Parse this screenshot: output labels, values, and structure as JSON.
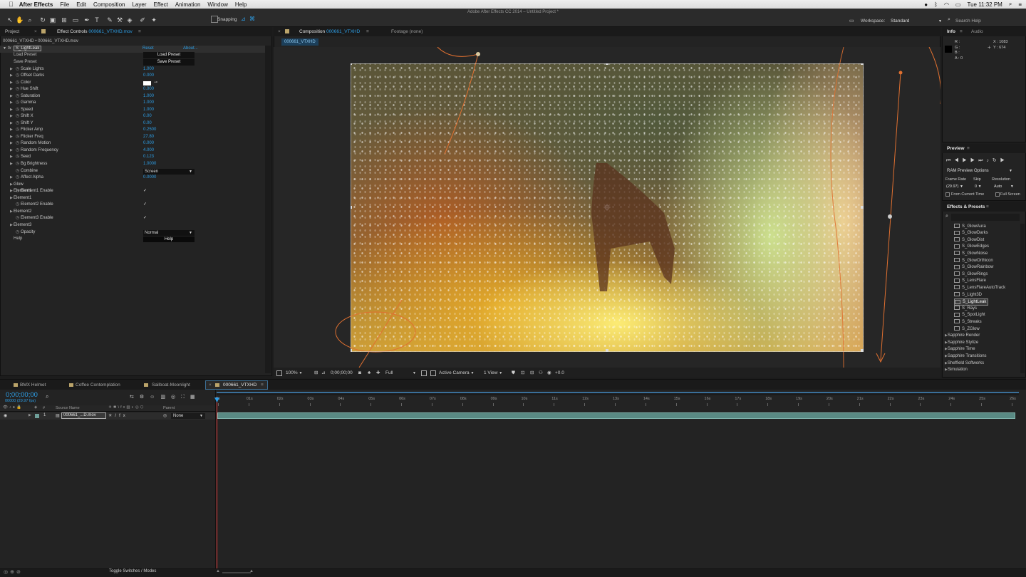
{
  "menubar": {
    "app": "After Effects",
    "items": [
      "File",
      "Edit",
      "Composition",
      "Layer",
      "Effect",
      "Animation",
      "Window",
      "Help"
    ],
    "clock": "Tue 11:32 PM"
  },
  "window_title": "Adobe After Effects CC 2014 – Untitled Project *",
  "toolbar": {
    "snapping": "Snapping",
    "workspace_label": "Workspace:",
    "workspace_value": "Standard",
    "search_help": "Search Help"
  },
  "project_tab": "Project",
  "effect_controls": {
    "tab_label": "Effect Controls",
    "tab_file": "000661_VTXHD.mov",
    "breadcrumb": "000661_VTXHD • 000661_VTXHD.mov",
    "effect_name": "S_LightLeak",
    "reset": "Reset",
    "about": "About...",
    "load_preset_label": "Load Preset",
    "save_preset_label": "Save Preset",
    "load_preset_btn": "Load Preset",
    "save_preset_btn": "Save Preset",
    "params": [
      {
        "label": "Scale Lights",
        "value": "1.000"
      },
      {
        "label": "Offset Darks",
        "value": "0.000"
      },
      {
        "label": "Color",
        "value": ""
      },
      {
        "label": "Hue Shift",
        "value": "0.000"
      },
      {
        "label": "Saturation",
        "value": "1.000"
      },
      {
        "label": "Gamma",
        "value": "1.000"
      },
      {
        "label": "Speed",
        "value": "1.000"
      },
      {
        "label": "Shift X",
        "value": "0.00"
      },
      {
        "label": "Shift Y",
        "value": "0.00"
      },
      {
        "label": "Flicker Amp",
        "value": "0.2500"
      },
      {
        "label": "Flicker Freq",
        "value": "27.80"
      },
      {
        "label": "Random Motion",
        "value": "0.000"
      },
      {
        "label": "Random Frequency",
        "value": "4.000"
      },
      {
        "label": "Seed",
        "value": "0.123"
      },
      {
        "label": "Bg Brightness",
        "value": "1.0000"
      }
    ],
    "combine_label": "Combine",
    "combine_value": "Screen",
    "affect_alpha_label": "Affect Alpha",
    "affect_alpha_value": "0.0000",
    "glow": "Glow",
    "element1": "Element1",
    "element1_enable": "Element1 Enable",
    "element2": "Element2",
    "element2_enable": "Element2 Enable",
    "element3": "Element3",
    "element3_enable": "Element3 Enable",
    "opacity_label": "Opacity",
    "opacity_value": "Normal",
    "help_label": "Help",
    "help_btn": "Help",
    "check": "✓"
  },
  "composition": {
    "tab_label": "Composition",
    "tab_name": "000661_VTXHD",
    "footage_tab": "Footage (none)",
    "subtab": "000661_VTXHD",
    "zoom": "100%",
    "timecode": "0;00;00;00",
    "resolution": "Full",
    "camera": "Active Camera",
    "view": "1 View",
    "exposure": "+0.0"
  },
  "info": {
    "tab": "Info",
    "audio_tab": "Audio",
    "r": "R :",
    "g": "G :",
    "b": "B :",
    "a": "A : 0",
    "x": "X : 1083",
    "y": "Y : 674"
  },
  "preview": {
    "title": "Preview",
    "ram_options": "RAM Preview Options",
    "frame_rate_label": "Frame Rate",
    "skip_label": "Skip",
    "resolution_label": "Resolution",
    "frame_rate_value": "(29.97)",
    "skip_value": "0",
    "resolution_value": "Auto",
    "from_current": "From Current Time",
    "full_screen": "Full Screen"
  },
  "effects_presets": {
    "title": "Effects & Presets",
    "search_placeholder": "",
    "items": [
      "S_GlowAura",
      "S_GlowDarks",
      "S_GlowDist",
      "S_GlowEdges",
      "S_GlowNoise",
      "S_GlowOrthicon",
      "S_GlowRainbow",
      "S_GlowRings",
      "S_LensFlare",
      "S_LensFlareAutoTrack",
      "S_Light3D",
      "S_LightLeak",
      "S_Rays",
      "S_SpotLight",
      "S_Streaks",
      "S_ZGlow"
    ],
    "selected": "S_LightLeak",
    "categories": [
      "Sapphire Render",
      "Sapphire Stylize",
      "Sapphire Time",
      "Sapphire Transitions",
      "Sheffield Softworks",
      "Simulation"
    ]
  },
  "timeline": {
    "tabs": [
      "BMX Helmet",
      "Coffee Contemplation",
      "Sailboat-Moonlight",
      "000661_VTXHD"
    ],
    "active_tab": "000661_VTXHD",
    "current_time": "0;00;00;00",
    "frames": "00000 (29.97 fps)",
    "col_num": "#",
    "col_source": "Source Name",
    "col_parent": "Parent",
    "layer_index": "1",
    "layer_name": "000661_...D.mov",
    "layer_parent": "None",
    "ruler": [
      "0s",
      "01s",
      "02s",
      "03s",
      "04s",
      "05s",
      "06s",
      "07s",
      "08s",
      "09s",
      "10s",
      "11s",
      "12s",
      "13s",
      "14s",
      "15s",
      "16s",
      "17s",
      "18s",
      "19s",
      "20s",
      "21s",
      "22s",
      "23s",
      "24s",
      "25s",
      "26s"
    ],
    "toggle": "Toggle Switches / Modes"
  },
  "colors": {
    "accent": "#2d9ee6",
    "panel_bg": "#232323",
    "layer_bar": "#5a8a84",
    "playhead": "#e03a3a",
    "motion_path": "#e07030"
  }
}
